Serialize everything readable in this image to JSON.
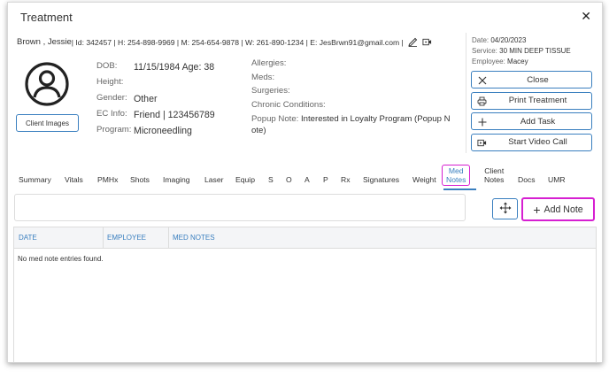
{
  "dialog": {
    "title": "Treatment",
    "close_glyph": "✕"
  },
  "patient_line": {
    "name": "Brown , Jessie",
    "details": " | Id: 342457 | H: 254-898-9969 | M: 254-654-9878 | W: 261-890-1234 | E: JesBrwn91@gmail.com |",
    "icons": [
      "edit-icon",
      "video-call-icon"
    ]
  },
  "client_images_label": "Client Images",
  "info": {
    "labels": [
      "DOB:",
      "Height:",
      "Gender:",
      "EC Info:",
      "Program:"
    ],
    "values": [
      "11/15/1984 Age: 38",
      "",
      "Other",
      "Friend | 123456789",
      "Microneedling"
    ]
  },
  "medical": {
    "rows": [
      "Allergies:",
      "Meds:",
      "Surgeries:",
      "Chronic Conditions:"
    ],
    "popup_label": "Popup Note:",
    "popup_value": "Interested in Loyalty Program (Popup N ote)"
  },
  "appointment": {
    "date_label": "Date:",
    "date_value": "04/20/2023",
    "service_label": "Service:",
    "service_value": "30 MIN DEEP TISSUE",
    "employee_label": "Employee:",
    "employee_value": "Macey"
  },
  "actions": {
    "close": "Close",
    "print": "Print Treatment",
    "add_task": "Add Task",
    "video": "Start Video Call"
  },
  "tabs": {
    "summary": "Summary",
    "vitals": "Vitals",
    "pmhx": "PMHx",
    "shots": "Shots",
    "imaging": "Imaging",
    "laser": "Laser",
    "equip": "Equip",
    "s": "S",
    "o": "O",
    "a": "A",
    "p": "P",
    "rx": "Rx",
    "signatures": "Signatures",
    "weight": "Weight",
    "med_notes_1": "Med",
    "med_notes_2": "Notes",
    "client_notes_1": "Client",
    "client_notes_2": "Notes",
    "docs": "Docs",
    "umr": "UMR"
  },
  "add_note_label": "Add Note",
  "table": {
    "columns": [
      "DATE",
      "EMPLOYEE",
      "MED NOTES"
    ],
    "empty_message": "No med note entries found."
  },
  "colors": {
    "accent": "#3a7fbf",
    "highlight": "#d61fd1"
  }
}
